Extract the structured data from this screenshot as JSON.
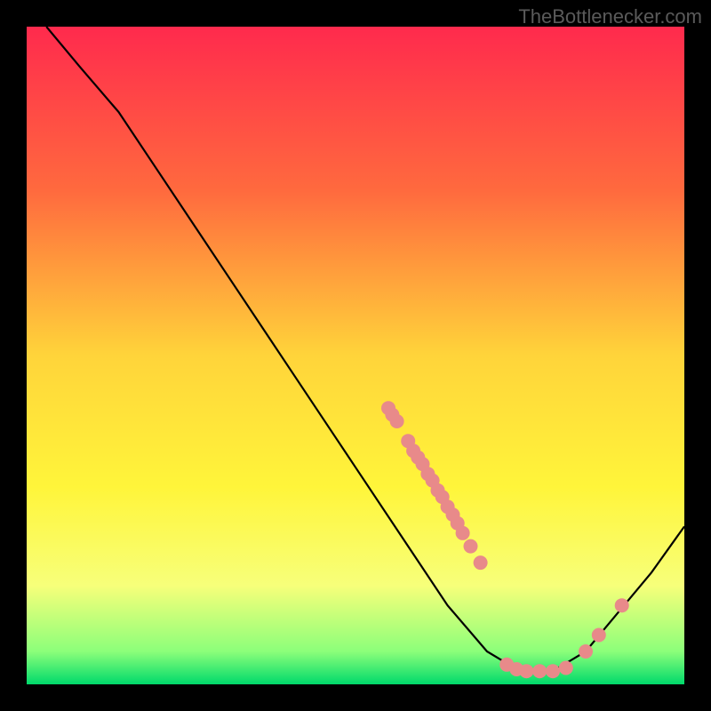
{
  "attribution": "TheBottlenecker.com",
  "chart_data": {
    "type": "line",
    "title": "",
    "xlabel": "",
    "ylabel": "",
    "xlim": [
      0,
      100
    ],
    "ylim": [
      0,
      100
    ],
    "background_gradient": {
      "stops": [
        {
          "pos": 0.0,
          "color": "#ff2a4d"
        },
        {
          "pos": 0.25,
          "color": "#ff6a3e"
        },
        {
          "pos": 0.5,
          "color": "#ffd43a"
        },
        {
          "pos": 0.7,
          "color": "#fff53a"
        },
        {
          "pos": 0.85,
          "color": "#f7ff7a"
        },
        {
          "pos": 0.95,
          "color": "#8cff7a"
        },
        {
          "pos": 1.0,
          "color": "#00d96b"
        }
      ]
    },
    "series": [
      {
        "name": "curve",
        "type": "line",
        "color": "#000000",
        "points": [
          {
            "x": 3,
            "y": 100
          },
          {
            "x": 8,
            "y": 94
          },
          {
            "x": 14,
            "y": 87
          },
          {
            "x": 20,
            "y": 78
          },
          {
            "x": 30,
            "y": 63
          },
          {
            "x": 40,
            "y": 48
          },
          {
            "x": 50,
            "y": 33
          },
          {
            "x": 58,
            "y": 21
          },
          {
            "x": 64,
            "y": 12
          },
          {
            "x": 70,
            "y": 5
          },
          {
            "x": 75,
            "y": 2
          },
          {
            "x": 80,
            "y": 2
          },
          {
            "x": 85,
            "y": 5
          },
          {
            "x": 90,
            "y": 11
          },
          {
            "x": 95,
            "y": 17
          },
          {
            "x": 100,
            "y": 24
          }
        ]
      },
      {
        "name": "markers",
        "type": "scatter",
        "color": "#e88a8a",
        "points": [
          {
            "x": 55,
            "y": 42
          },
          {
            "x": 55.6,
            "y": 41
          },
          {
            "x": 56.3,
            "y": 40
          },
          {
            "x": 58,
            "y": 37
          },
          {
            "x": 58.8,
            "y": 35.5
          },
          {
            "x": 59.5,
            "y": 34.5
          },
          {
            "x": 60.2,
            "y": 33.5
          },
          {
            "x": 61,
            "y": 32
          },
          {
            "x": 61.7,
            "y": 31
          },
          {
            "x": 62.5,
            "y": 29.5
          },
          {
            "x": 63.2,
            "y": 28.5
          },
          {
            "x": 64,
            "y": 27
          },
          {
            "x": 64.8,
            "y": 25.8
          },
          {
            "x": 65.5,
            "y": 24.5
          },
          {
            "x": 66.3,
            "y": 23
          },
          {
            "x": 67.5,
            "y": 21
          },
          {
            "x": 69,
            "y": 18.5
          },
          {
            "x": 73,
            "y": 3
          },
          {
            "x": 74.5,
            "y": 2.3
          },
          {
            "x": 76,
            "y": 2
          },
          {
            "x": 78,
            "y": 2
          },
          {
            "x": 80,
            "y": 2
          },
          {
            "x": 82,
            "y": 2.5
          },
          {
            "x": 85,
            "y": 5
          },
          {
            "x": 87,
            "y": 7.5
          },
          {
            "x": 90.5,
            "y": 12
          }
        ]
      }
    ]
  }
}
